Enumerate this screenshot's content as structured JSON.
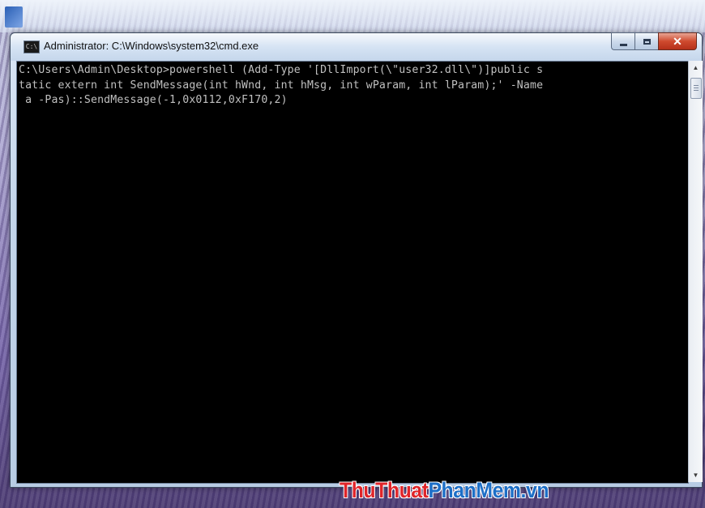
{
  "window": {
    "title": "Administrator: C:\\Windows\\system32\\cmd.exe",
    "icon_label": "C:\\"
  },
  "console": {
    "text": "C:\\Users\\Admin\\Desktop>powershell (Add-Type '[DllImport(\\\"user32.dll\\\")]public s\ntatic extern int SendMessage(int hWnd, int hMsg, int wParam, int lParam);' -Name\n a -Pas)::SendMessage(-1,0x0112,0xF170,2)"
  },
  "watermark": {
    "part1": "ThuThuat",
    "part2": "PhanMem",
    "part3": ".vn"
  },
  "icons": {
    "minimize": "minimize-icon",
    "maximize": "maximize-icon",
    "close": "close-icon",
    "scroll_up": "scroll-up-arrow-icon",
    "scroll_down": "scroll-down-arrow-icon"
  },
  "colors": {
    "console_bg": "#000000",
    "console_text": "#c0c0c0",
    "close_button": "#c8432a",
    "watermark_red": "#e0252a",
    "watermark_blue": "#1d6fc7"
  }
}
